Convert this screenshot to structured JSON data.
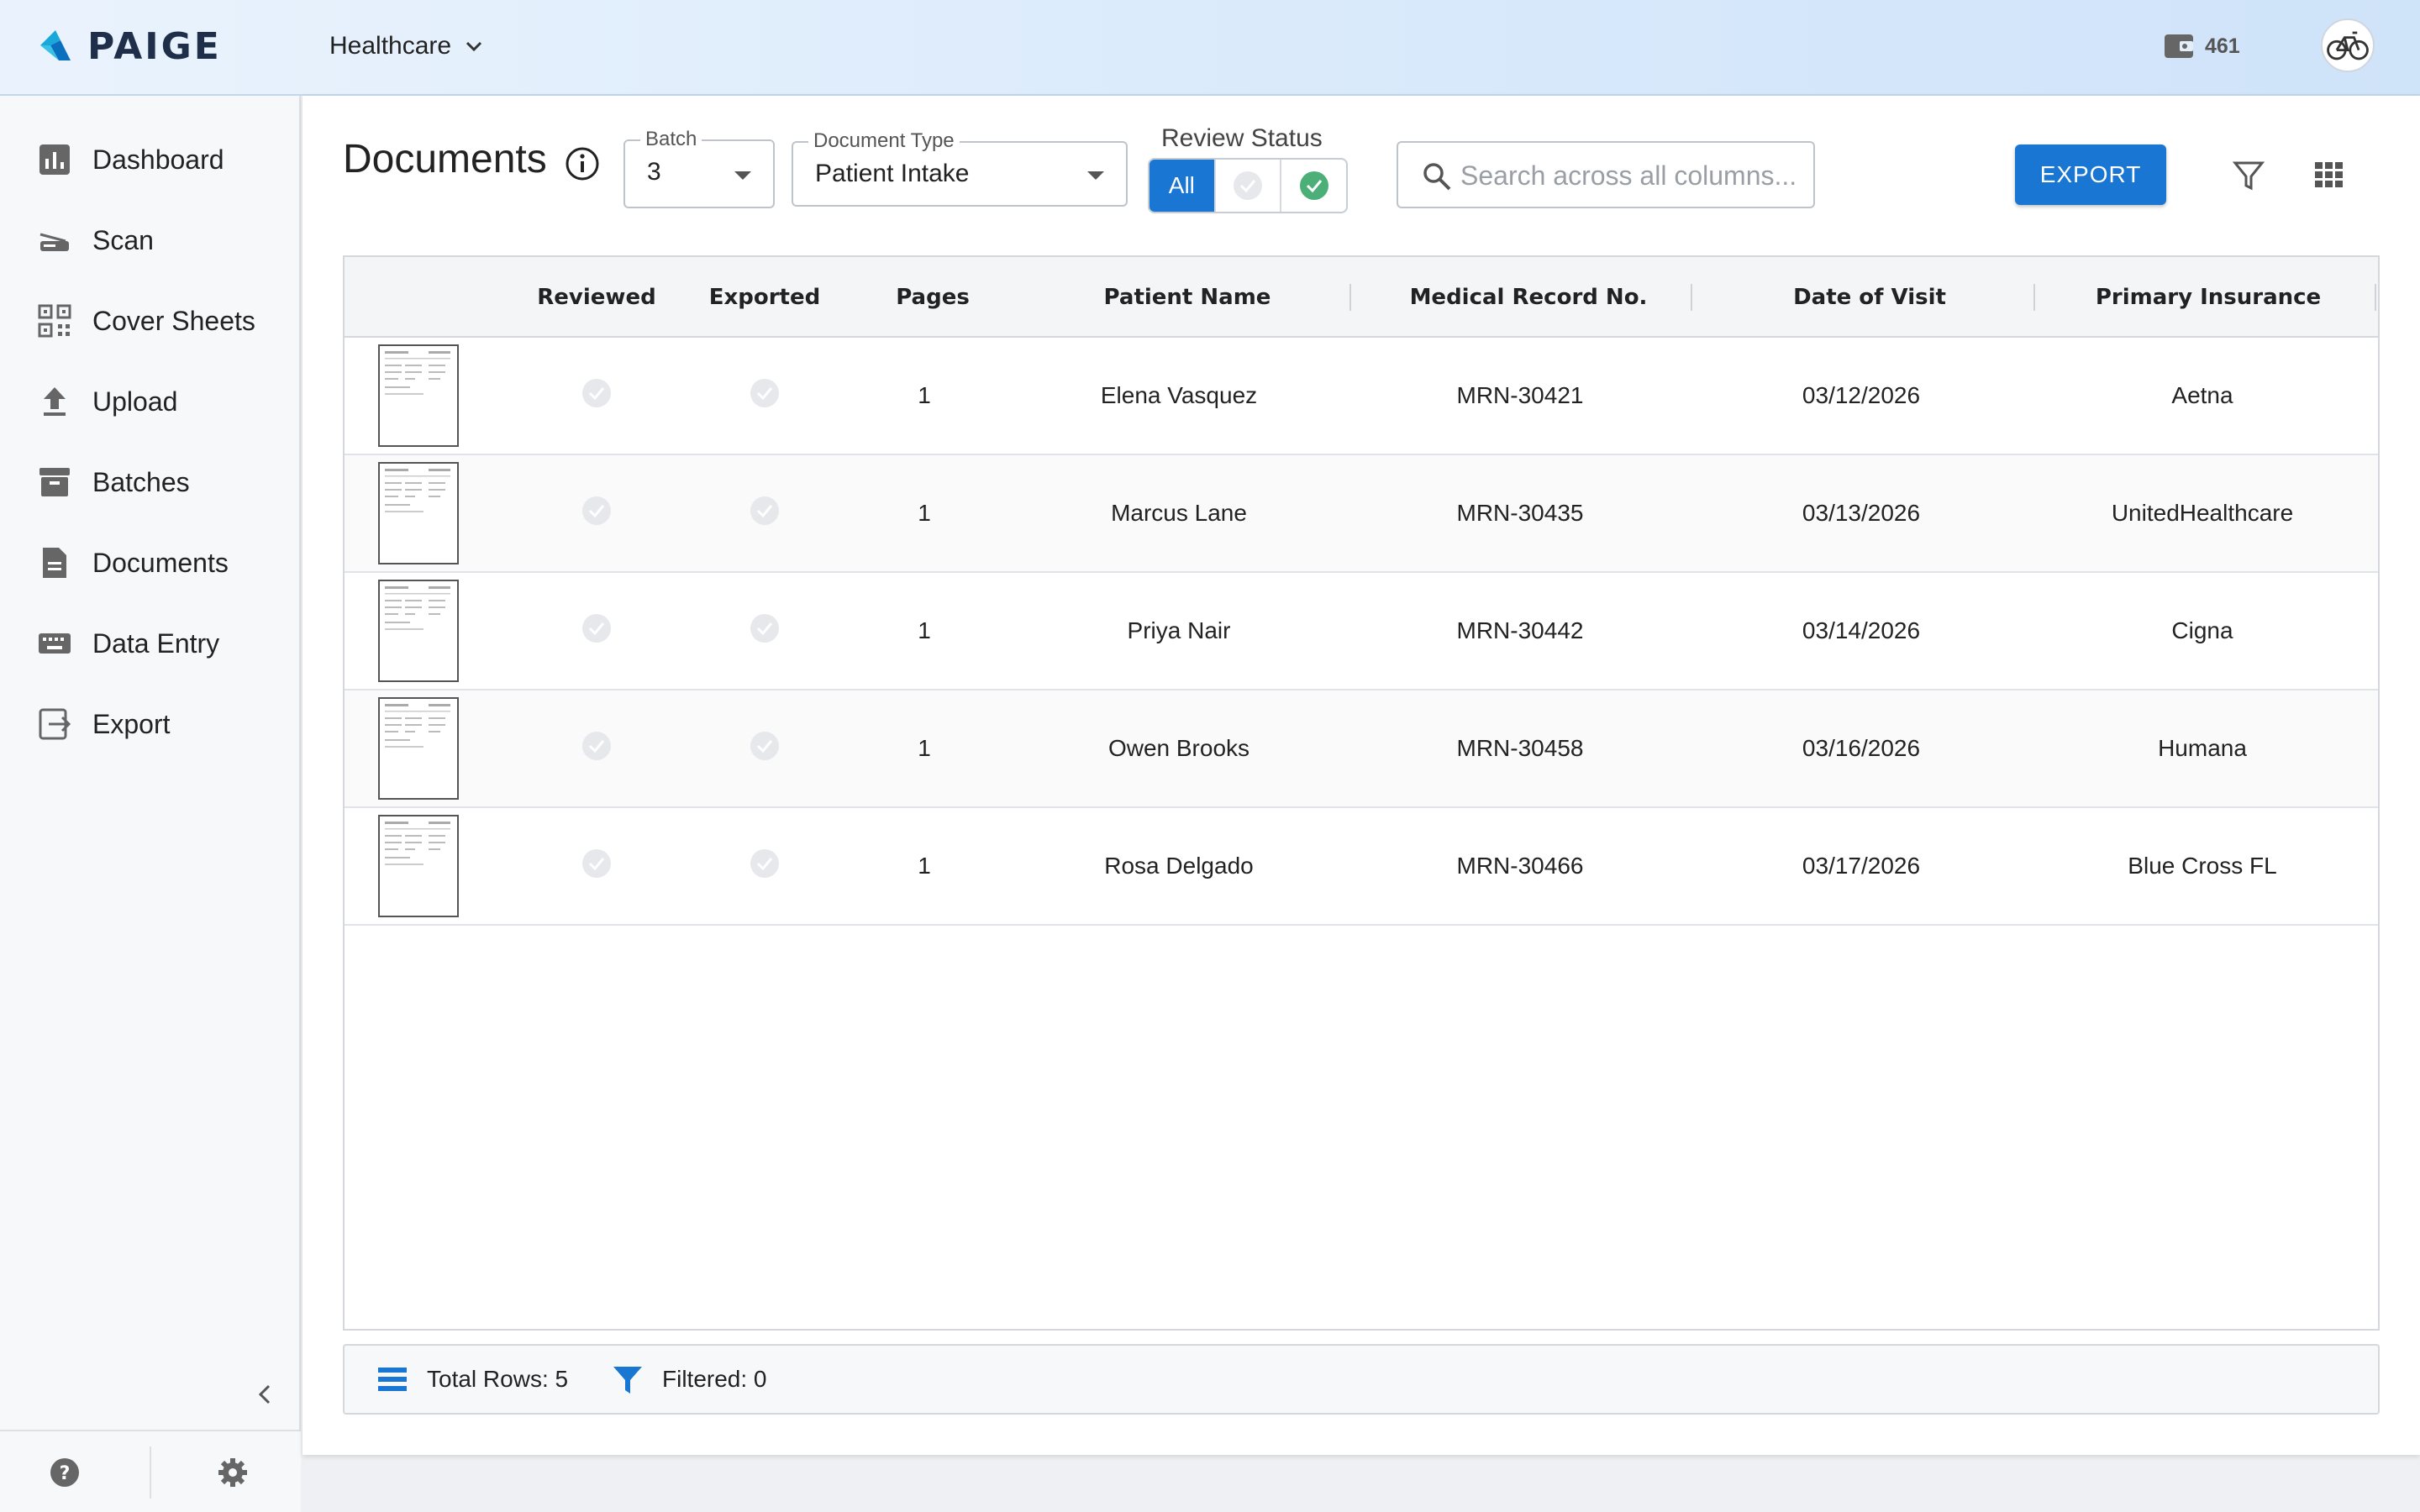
{
  "header": {
    "brand": "PAIGE",
    "workspace": "Healthcare",
    "credits": "461"
  },
  "sidebar": {
    "items": [
      {
        "label": "Dashboard",
        "icon": "bar-chart-icon"
      },
      {
        "label": "Scan",
        "icon": "scanner-icon"
      },
      {
        "label": "Cover Sheets",
        "icon": "qr-code-icon"
      },
      {
        "label": "Upload",
        "icon": "upload-icon"
      },
      {
        "label": "Batches",
        "icon": "archive-icon"
      },
      {
        "label": "Documents",
        "icon": "document-icon"
      },
      {
        "label": "Data Entry",
        "icon": "keyboard-icon"
      },
      {
        "label": "Export",
        "icon": "export-icon"
      }
    ]
  },
  "main": {
    "title": "Documents",
    "batch": {
      "label": "Batch",
      "value": "3"
    },
    "doc_type": {
      "label": "Document Type",
      "value": "Patient Intake"
    },
    "review_status": {
      "label": "Review Status",
      "all": "All",
      "selected": "All"
    },
    "search": {
      "placeholder": "Search across all columns...",
      "value": ""
    },
    "export_label": "EXPORT"
  },
  "table": {
    "columns": [
      "Reviewed",
      "Exported",
      "Pages",
      "Patient Name",
      "Medical Record No.",
      "Date of Visit",
      "Primary Insurance"
    ],
    "rows": [
      {
        "reviewed": false,
        "exported": false,
        "pages": "1",
        "patient": "Elena Vasquez",
        "mrn": "MRN-30421",
        "date": "03/12/2026",
        "insurance": "Aetna"
      },
      {
        "reviewed": false,
        "exported": false,
        "pages": "1",
        "patient": "Marcus Lane",
        "mrn": "MRN-30435",
        "date": "03/13/2026",
        "insurance": "UnitedHealthcare"
      },
      {
        "reviewed": false,
        "exported": false,
        "pages": "1",
        "patient": "Priya Nair",
        "mrn": "MRN-30442",
        "date": "03/14/2026",
        "insurance": "Cigna"
      },
      {
        "reviewed": false,
        "exported": false,
        "pages": "1",
        "patient": "Owen Brooks",
        "mrn": "MRN-30458",
        "date": "03/16/2026",
        "insurance": "Humana"
      },
      {
        "reviewed": false,
        "exported": false,
        "pages": "1",
        "patient": "Rosa Delgado",
        "mrn": "MRN-30466",
        "date": "03/17/2026",
        "insurance": "Blue Cross FL"
      }
    ]
  },
  "footer": {
    "total_rows": "Total Rows: 5",
    "filtered": "Filtered: 0"
  },
  "colors": {
    "accent": "#1976d2",
    "check_done": "#4caf78",
    "check_pending": "#e6e8eb"
  }
}
